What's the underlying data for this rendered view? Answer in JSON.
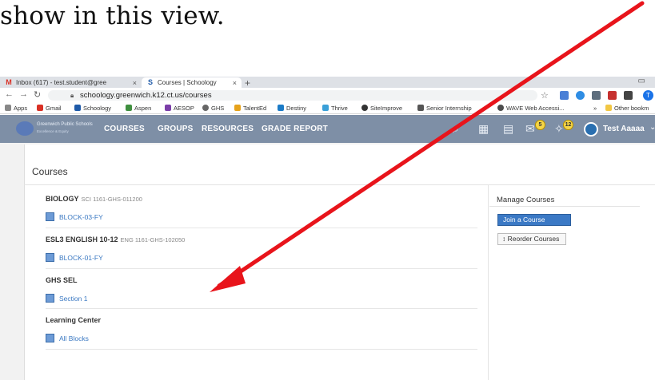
{
  "doc_text": "show in this view.",
  "browser": {
    "tabs": [
      {
        "label": "Inbox (617) - test.student@gree",
        "close": "×"
      },
      {
        "label": "Courses | Schoology",
        "close": "×"
      }
    ],
    "new_tab": "+",
    "url": "schoology.greenwich.k12.ct.us/courses",
    "bookmarks": [
      "Apps",
      "Gmail",
      "Schoology",
      "Aspen",
      "AESOP",
      "GHS",
      "TalentEd",
      "Destiny",
      "Thrive",
      "SiteImprove",
      "Senior Internship",
      "WAVE Web Accessi..."
    ],
    "bookmarks_more": "»",
    "other_bookmarks": "Other bookm",
    "profile_initial": "T"
  },
  "header": {
    "logo_text": "Greenwich Public Schools",
    "logo_sub": "Excellence & Equity",
    "menu": [
      "COURSES",
      "GROUPS",
      "RESOURCES",
      "GRADE REPORT"
    ],
    "messages_count": "5",
    "notifications_count": "12",
    "user_name": "Test Aaaaa",
    "user_caret": "⌄"
  },
  "courses": {
    "title": "Courses",
    "items": [
      {
        "name": "BIOLOGY",
        "code": "SCI 1161-GHS-011200",
        "section": "BLOCK-03-FY"
      },
      {
        "name": "ESL3 ENGLISH 10-12",
        "code": "ENG 1161-GHS-102050",
        "section": "BLOCK-01-FY"
      },
      {
        "name": "GHS SEL",
        "code": "",
        "section": "Section 1"
      },
      {
        "name": "Learning Center",
        "code": "",
        "section": "All Blocks"
      }
    ]
  },
  "manage": {
    "title": "Manage Courses",
    "join_label": "Join a Course",
    "reorder_label": "↕ Reorder Courses"
  },
  "colors": {
    "header_bg": "#7e8fa6",
    "link": "#3a78c2",
    "button_primary": "#3b79c5",
    "annotation_arrow": "#e8141b"
  }
}
